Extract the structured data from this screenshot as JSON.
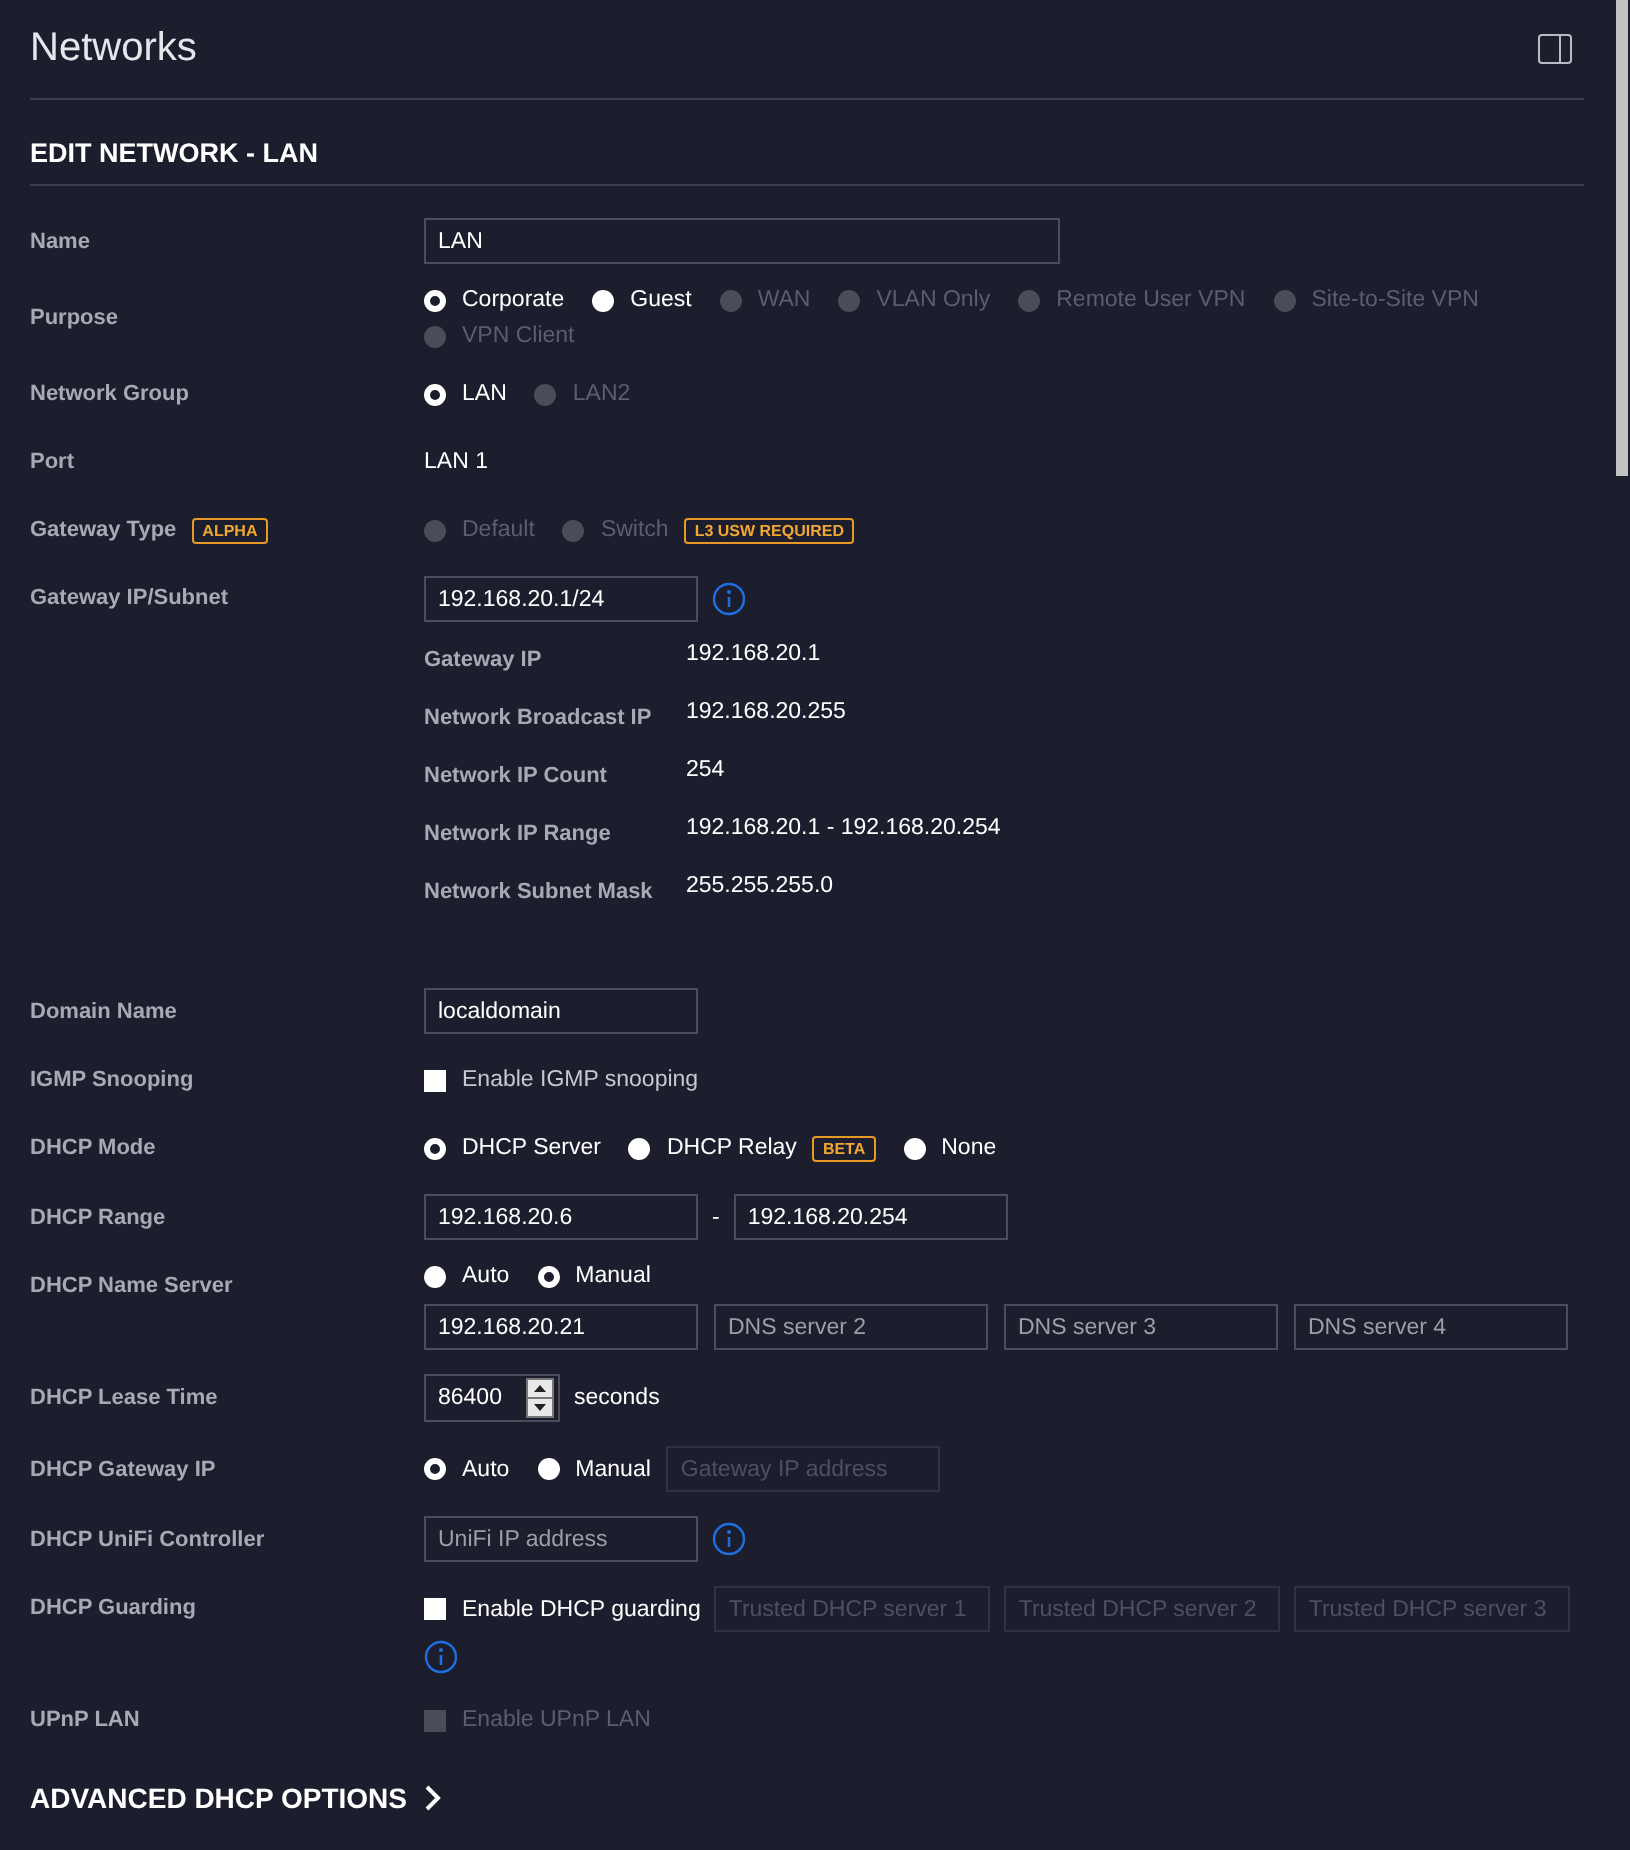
{
  "header": {
    "title": "Networks"
  },
  "section": {
    "title": "EDIT NETWORK - LAN"
  },
  "name": {
    "label": "Name",
    "value": "LAN"
  },
  "purpose": {
    "label": "Purpose",
    "options": [
      {
        "label": "Corporate",
        "selected": true,
        "disabled": false
      },
      {
        "label": "Guest",
        "selected": false,
        "disabled": false
      },
      {
        "label": "WAN",
        "selected": false,
        "disabled": true
      },
      {
        "label": "VLAN Only",
        "selected": false,
        "disabled": true
      },
      {
        "label": "Remote User VPN",
        "selected": false,
        "disabled": true
      },
      {
        "label": "Site-to-Site VPN",
        "selected": false,
        "disabled": true
      },
      {
        "label": "VPN Client",
        "selected": false,
        "disabled": true
      }
    ]
  },
  "network_group": {
    "label": "Network Group",
    "options": [
      {
        "label": "LAN",
        "selected": true,
        "disabled": false
      },
      {
        "label": "LAN2",
        "selected": false,
        "disabled": true
      }
    ]
  },
  "port": {
    "label": "Port",
    "value": "LAN 1"
  },
  "gateway_type": {
    "label": "Gateway Type",
    "badge": "ALPHA",
    "options": [
      {
        "label": "Default",
        "selected": false,
        "disabled": true
      },
      {
        "label": "Switch",
        "selected": false,
        "disabled": true,
        "badge": "L3 USW REQUIRED"
      }
    ]
  },
  "gateway_subnet": {
    "label": "Gateway IP/Subnet",
    "value": "192.168.20.1/24",
    "details": [
      {
        "label": "Gateway IP",
        "value": "192.168.20.1"
      },
      {
        "label": "Network Broadcast IP",
        "value": "192.168.20.255"
      },
      {
        "label": "Network IP Count",
        "value": "254"
      },
      {
        "label": "Network IP Range",
        "value": "192.168.20.1 - 192.168.20.254"
      },
      {
        "label": "Network Subnet Mask",
        "value": "255.255.255.0"
      }
    ]
  },
  "domain_name": {
    "label": "Domain Name",
    "value": "localdomain"
  },
  "igmp_snooping": {
    "label": "IGMP Snooping",
    "checkbox": {
      "label": "Enable IGMP snooping",
      "checked": false,
      "disabled": false
    }
  },
  "dhcp_mode": {
    "label": "DHCP Mode",
    "options": [
      {
        "label": "DHCP Server",
        "selected": true,
        "disabled": false
      },
      {
        "label": "DHCP Relay",
        "selected": false,
        "disabled": false,
        "badge": "BETA"
      },
      {
        "label": "None",
        "selected": false,
        "disabled": false
      }
    ]
  },
  "dhcp_range": {
    "label": "DHCP Range",
    "start": "192.168.20.6",
    "separator": "-",
    "end": "192.168.20.254"
  },
  "dhcp_name_server": {
    "label": "DHCP Name Server",
    "options": [
      {
        "label": "Auto",
        "selected": false,
        "disabled": false
      },
      {
        "label": "Manual",
        "selected": true,
        "disabled": false
      }
    ],
    "servers": [
      {
        "value": "192.168.20.21"
      },
      {
        "placeholder": "DNS server 2"
      },
      {
        "placeholder": "DNS server 3"
      },
      {
        "placeholder": "DNS server 4"
      }
    ]
  },
  "dhcp_lease_time": {
    "label": "DHCP Lease Time",
    "value": "86400",
    "unit": "seconds"
  },
  "dhcp_gateway_ip": {
    "label": "DHCP Gateway IP",
    "options": [
      {
        "label": "Auto",
        "selected": true,
        "disabled": false
      },
      {
        "label": "Manual",
        "selected": false,
        "disabled": false
      }
    ],
    "field": {
      "placeholder": "Gateway IP address",
      "disabled": true
    }
  },
  "dhcp_unifi_controller": {
    "label": "DHCP UniFi Controller",
    "placeholder": "UniFi IP address"
  },
  "dhcp_guarding": {
    "label": "DHCP Guarding",
    "checkbox": {
      "label": "Enable DHCP guarding",
      "checked": false,
      "disabled": false
    },
    "servers": [
      {
        "placeholder": "Trusted DHCP server 1",
        "disabled": true
      },
      {
        "placeholder": "Trusted DHCP server 2",
        "disabled": true
      },
      {
        "placeholder": "Trusted DHCP server 3",
        "disabled": true
      }
    ]
  },
  "upnp_lan": {
    "label": "UPnP LAN",
    "checkbox": {
      "label": "Enable UPnP LAN",
      "checked": false,
      "disabled": true
    }
  },
  "advanced": {
    "label": "ADVANCED DHCP OPTIONS"
  }
}
